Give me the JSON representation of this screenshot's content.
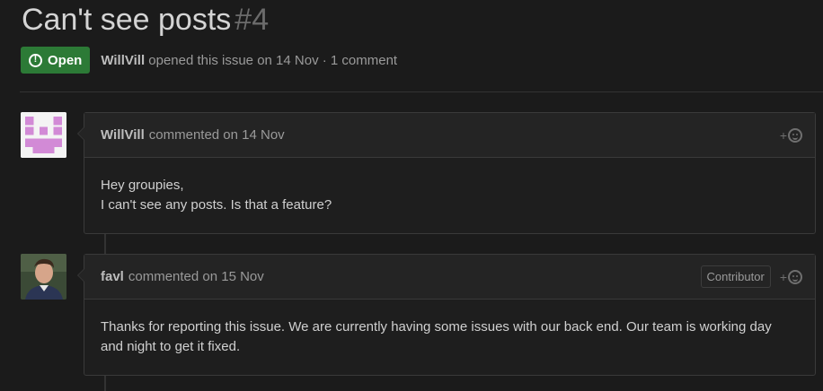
{
  "issue": {
    "title": "Can't see posts",
    "number": "#4",
    "status": "Open",
    "author": "WillVill",
    "meta_text": "opened this issue on 14 Nov · 1 comment"
  },
  "comments": [
    {
      "author": "WillVill",
      "action": "commented on 14 Nov",
      "body_line1": "Hey groupies,",
      "body_line2": "I can't see any posts. Is that a feature?",
      "reaction_plus": "+"
    },
    {
      "author": "favl",
      "action": "commented on 15 Nov",
      "role": "Contributor",
      "body": "Thanks for reporting this issue. We are currently having some issues with our back end. Our team is working day and night to get it fixed.",
      "reaction_plus": "+"
    }
  ],
  "colors": {
    "open_badge": "#2c7a36",
    "background": "#1b1b1b",
    "avatar1_pattern": "#d28ad6"
  }
}
